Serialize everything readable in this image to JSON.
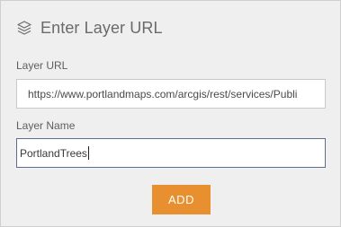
{
  "dialog": {
    "title": "Enter Layer URL",
    "icon": "layers-icon"
  },
  "layer_url": {
    "label": "Layer URL",
    "value": "https://www.portlandmaps.com/arcgis/rest/services/Publi"
  },
  "layer_name": {
    "label": "Layer Name",
    "value": "PortlandTrees"
  },
  "actions": {
    "add_label": "ADD"
  },
  "colors": {
    "accent": "#e8902f",
    "panel_bg": "#efefef",
    "focus_border": "#5a6f90"
  }
}
